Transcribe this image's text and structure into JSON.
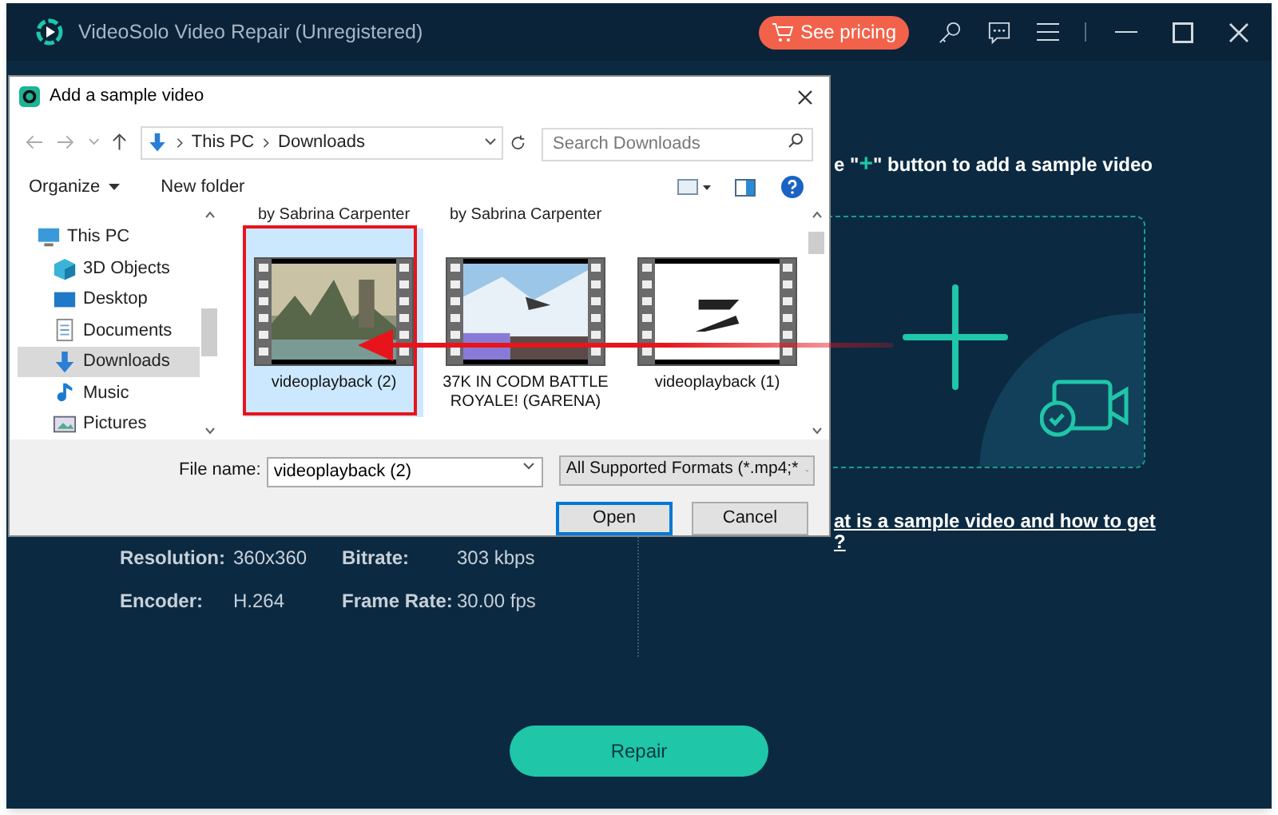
{
  "app": {
    "title": "VideoSolo Video Repair (Unregistered)",
    "pricing_button": "See pricing"
  },
  "instruction": {
    "before": "e \"",
    "plus": "+",
    "after": "\" button to add a sample video"
  },
  "help_link": {
    "lines": [
      "at is a sample video and how to get",
      "?"
    ]
  },
  "video_info": [
    {
      "label": "Resolution:",
      "value": "360x360"
    },
    {
      "label": "Bitrate:",
      "value": "303 kbps"
    },
    {
      "label": "Encoder:",
      "value": "H.264"
    },
    {
      "label": "Frame Rate:",
      "value": "30.00 fps"
    }
  ],
  "repair_button": "Repair",
  "dialog": {
    "title": "Add a sample video",
    "breadcrumb": [
      "This PC",
      "Downloads"
    ],
    "search": {
      "placeholder": "Search Downloads"
    },
    "organize": "Organize",
    "new_folder": "New folder",
    "nav_items": [
      {
        "label": "This PC",
        "kind": "pc",
        "selected": false,
        "children": [
          {
            "label": "3D Objects",
            "kind": "cube",
            "selected": false
          },
          {
            "label": "Desktop",
            "kind": "desktop",
            "selected": false
          },
          {
            "label": "Documents",
            "kind": "document",
            "selected": false
          },
          {
            "label": "Downloads",
            "kind": "download",
            "selected": true
          },
          {
            "label": "Music",
            "kind": "music",
            "selected": false
          },
          {
            "label": "Pictures",
            "kind": "pictures",
            "selected": false
          }
        ]
      }
    ],
    "cut_captions": [
      "by Sabrina Carpenter",
      "by Sabrina Carpenter"
    ],
    "files": [
      {
        "name": "videoplayback (2)",
        "kind": "beach",
        "selected": true
      },
      {
        "name": "37K IN CODM BATTLE ROYALE! (GARENA)",
        "kind": "snow",
        "selected": false
      },
      {
        "name": "videoplayback (1)",
        "kind": "logo",
        "selected": false
      }
    ],
    "file_name_label": "File name:",
    "file_name": "videoplayback (2)",
    "filter": "All Supported Formats (*.mp4;*",
    "buttons": [
      "Open",
      "Cancel"
    ]
  }
}
